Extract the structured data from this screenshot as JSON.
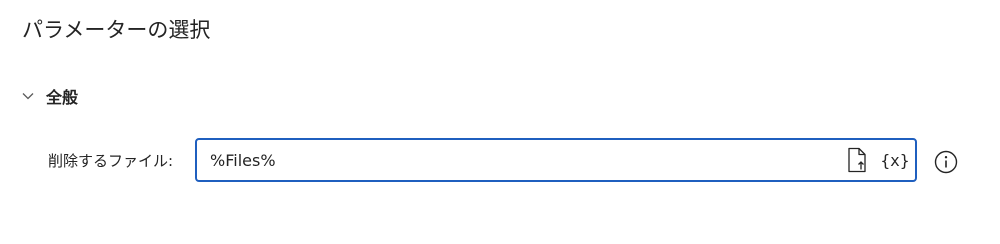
{
  "dialog": {
    "title": "パラメーターの選択"
  },
  "section": {
    "title": "全般",
    "expanded": true,
    "chevron_icon": "chevron-down-icon"
  },
  "parameter": {
    "label": "削除するファイル:",
    "value": "%Files%",
    "file_picker_icon": "file-select-icon",
    "variable_button_label": "{x}",
    "info_icon": "info-icon"
  },
  "colors": {
    "text": "#242424",
    "input_border_focus": "#1f5fbf",
    "background": "#ffffff"
  }
}
